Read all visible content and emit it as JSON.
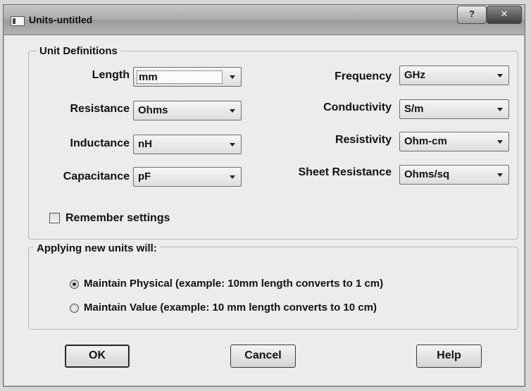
{
  "window": {
    "title": "Units-untitled",
    "help_glyph": "?",
    "close_glyph": "✕"
  },
  "unit_definitions": {
    "group_label": "Unit Definitions",
    "fields": [
      {
        "label": "Length",
        "value": "mm"
      },
      {
        "label": "Resistance",
        "value": "Ohms"
      },
      {
        "label": "Inductance",
        "value": "nH"
      },
      {
        "label": "Capacitance",
        "value": "pF"
      },
      {
        "label": "Frequency",
        "value": "GHz"
      },
      {
        "label": "Conductivity",
        "value": "S/m"
      },
      {
        "label": "Resistivity",
        "value": "Ohm-cm"
      },
      {
        "label": "Sheet Resistance",
        "value": "Ohms/sq"
      }
    ],
    "remember_settings": {
      "label": "Remember settings",
      "checked": false
    }
  },
  "apply": {
    "group_label": "Applying new units will:",
    "options": [
      {
        "label": "Maintain Physical (example: 10mm length converts to 1 cm)",
        "selected": true
      },
      {
        "label": "Maintain Value (example: 10 mm length converts to 10 cm)",
        "selected": false
      }
    ]
  },
  "buttons": {
    "ok": "OK",
    "cancel": "Cancel",
    "help": "Help"
  }
}
